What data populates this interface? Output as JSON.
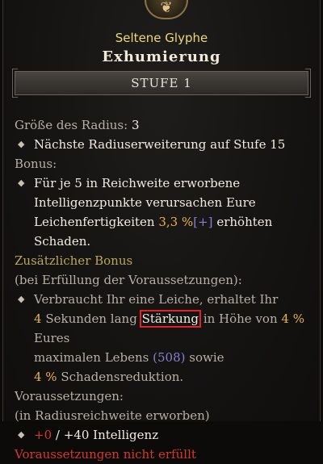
{
  "glyph": {
    "rarity": "Seltene Glyphe",
    "name": "Exhumierung",
    "level": "STUFE 1"
  },
  "radius": {
    "label": "Größe des Radius:",
    "value": "3",
    "next": "Nächste Radiuserweiterung auf Stufe 15"
  },
  "bonus": {
    "header": "Bonus:",
    "line1": "Für je 5 in Reichweite erworbene",
    "line2": "Intelligenzpunkte verursachen Eure",
    "skill": "Leichenfertigkeiten",
    "percent": "3,3 %",
    "plus": "[+]",
    "rest": "erhöhten Schaden."
  },
  "additional": {
    "header": "Zusätzlicher Bonus",
    "condition": "(bei Erfüllung der Voraussetzungen):",
    "line1": "Verbraucht Ihr eine Leiche, erhaltet Ihr",
    "sec_value": "4",
    "sec_text": "Sekunden lang",
    "keyword": "Stärkung",
    "in_height": "in Höhe von",
    "pct": "4 %",
    "eures": "Eures",
    "max_life": "maximalen Lebens",
    "life_value": "(508)",
    "sowie": "sowie",
    "dr_pct": "4 %",
    "dr_text": "Schadensreduktion."
  },
  "requirements": {
    "header": "Voraussetzungen:",
    "scope": "(in Radiusreichweite erworben)",
    "current": "+0",
    "separator": "/",
    "needed": "+40 Intelligenz",
    "unmet": "Voraussetzungen nicht erfüllt"
  },
  "colors": {
    "gold": "#e7b44a",
    "purple": "#8a7fd4",
    "unmet_red": "#d23a2c",
    "highlight_box": "#e0232a"
  },
  "icons": {
    "emblem": "glyph-emblem-icon",
    "bullet": "diamond-bullet-icon"
  }
}
